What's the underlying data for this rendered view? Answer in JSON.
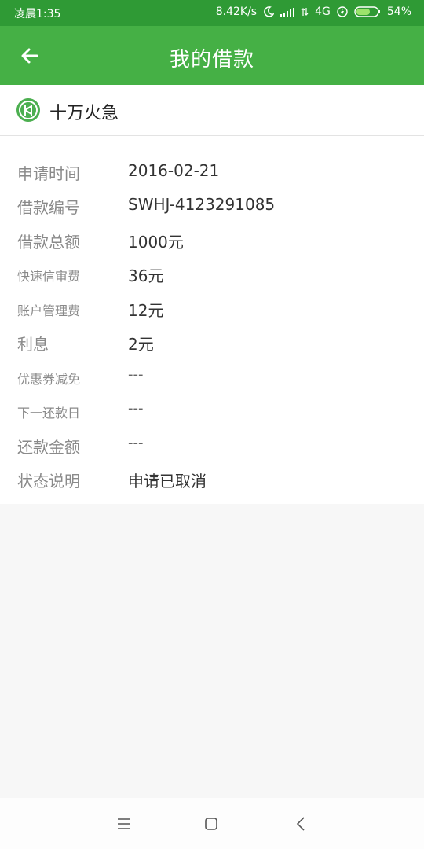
{
  "status_bar": {
    "time": "凌晨1:35",
    "speed": "8.42K/s",
    "network": "4G",
    "battery": "54%"
  },
  "app_bar": {
    "title": "我的借款"
  },
  "product": {
    "name": "十万火急"
  },
  "details": [
    {
      "label": "申请时间",
      "value": "2016-02-21"
    },
    {
      "label": "借款编号",
      "value": "SWHJ-4123291085"
    },
    {
      "label": "借款总额",
      "value": "1000元"
    },
    {
      "label": "快速信审费",
      "value": "36元"
    },
    {
      "label": "账户管理费",
      "value": "12元"
    },
    {
      "label": "利息",
      "value": "2元"
    },
    {
      "label": "优惠券减免",
      "value": "---"
    },
    {
      "label": "下一还款日",
      "value": "---"
    },
    {
      "label": "还款金额",
      "value": "---"
    },
    {
      "label": "状态说明",
      "value": "申请已取消"
    }
  ],
  "colors": {
    "status_bar": "#2f9a35",
    "app_bar": "#45b045",
    "accent": "#4caf50"
  }
}
